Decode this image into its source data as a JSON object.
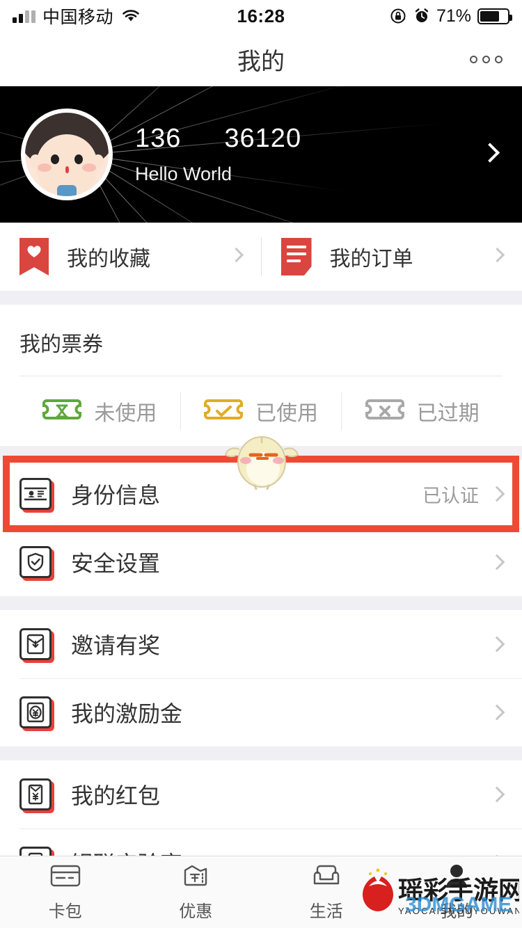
{
  "statusbar": {
    "carrier": "中国移动",
    "time": "16:28",
    "battery_pct": "71%",
    "icons": [
      "signal-icon",
      "wifi-icon",
      "rotation-lock-icon",
      "alarm-icon",
      "battery-icon"
    ]
  },
  "navbar": {
    "title": "我的",
    "more_icon": "more-dots-icon"
  },
  "profile": {
    "phone_prefix": "136",
    "phone_suffix": "36120",
    "nickname": "Hello World",
    "avatar_icon": "avatar-boy-icon",
    "chevron_icon": "chevron-right-icon"
  },
  "quick_row": [
    {
      "label": "我的收藏",
      "icon": "bookmark-heart-icon"
    },
    {
      "label": "我的订单",
      "icon": "order-document-icon"
    }
  ],
  "tickets": {
    "title": "我的票券",
    "items": [
      {
        "label": "未使用",
        "icon": "ticket-hourglass-icon",
        "color": "#5ea83a"
      },
      {
        "label": "已使用",
        "icon": "ticket-check-icon",
        "color": "#e0ac25"
      },
      {
        "label": "已过期",
        "icon": "ticket-cross-icon",
        "color": "#a8a8a8"
      }
    ]
  },
  "menu_groups": [
    {
      "rows": [
        {
          "label": "身份信息",
          "value": "已认证",
          "icon": "id-card-icon",
          "highlighted": true
        },
        {
          "label": "安全设置",
          "value": "",
          "icon": "shield-check-icon",
          "highlighted": false
        }
      ]
    },
    {
      "rows": [
        {
          "label": "邀请有奖",
          "value": "",
          "icon": "invite-reward-icon",
          "highlighted": false
        },
        {
          "label": "我的激励金",
          "value": "",
          "icon": "incentive-coin-icon",
          "highlighted": false
        }
      ]
    },
    {
      "rows": [
        {
          "label": "我的红包",
          "value": "",
          "icon": "red-packet-icon",
          "highlighted": false
        },
        {
          "label": "银联实验室",
          "value": "",
          "icon": "lightbulb-lab-icon",
          "highlighted": false
        }
      ]
    }
  ],
  "tabbar": [
    {
      "label": "卡包",
      "icon": "card-package-icon"
    },
    {
      "label": "优惠",
      "icon": "coupon-icon"
    },
    {
      "label": "生活",
      "icon": "sofa-life-icon"
    },
    {
      "label": "我的",
      "icon": "person-profile-icon"
    }
  ],
  "overlays": {
    "mascot_icon": "chick-mascot-icon",
    "watermark_cn": "瑶彩手游网",
    "watermark_pinyin": "YAOCAISHOUYOUWANG",
    "watermark_sub": "3DMGAME",
    "highlight_color": "#ee4a33"
  }
}
